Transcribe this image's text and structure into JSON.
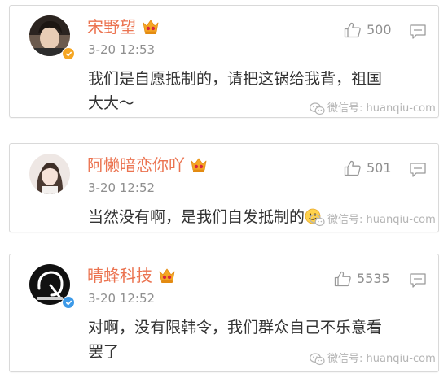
{
  "colors": {
    "username": "#eb7350",
    "meta": "#8f8f8f",
    "content": "#333333",
    "border": "#d9d9d9",
    "crown": "#f5a623",
    "verified_gold": "#f5a623",
    "verified_blue": "#3d9ae8",
    "watermark": "#b4b4b4"
  },
  "watermark": {
    "icon": "wechat-icon",
    "text": "微信号: huanqiu-com"
  },
  "comments": [
    {
      "username": "宋野望",
      "badge": "crown-icon",
      "verified": "gold",
      "timestamp": "3-20 12:53",
      "likes": "500",
      "content_lines": [
        "我们是自愿抵制的，请把这锅给我背，祖国",
        "大大～"
      ]
    },
    {
      "username": "阿懒暗恋你吖",
      "badge": "crown-icon",
      "verified": "none",
      "timestamp": "3-20 12:52",
      "likes": "501",
      "content": "当然没有啊，是我们自发抵制的",
      "emoji": "smiley-icon"
    },
    {
      "username": "晴蜂科技",
      "badge": "crown-icon",
      "verified": "blue",
      "timestamp": "3-20 12:52",
      "likes": "5535",
      "content_lines": [
        "对啊，没有限韩令，我们群众自己不乐意看",
        "罢了"
      ]
    }
  ]
}
